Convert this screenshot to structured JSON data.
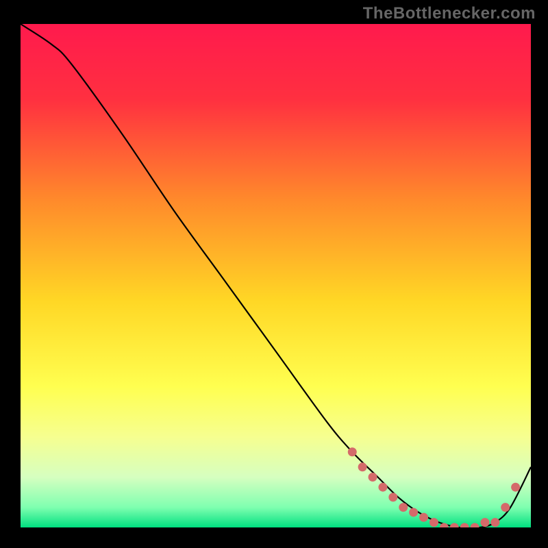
{
  "attribution": "TheBottlenecker.com",
  "chart_data": {
    "type": "line",
    "title": "",
    "xlabel": "",
    "ylabel": "",
    "xlim": [
      0,
      100
    ],
    "ylim": [
      0,
      100
    ],
    "background_gradient_stops": [
      {
        "offset": 0,
        "color": "#ff1a4d"
      },
      {
        "offset": 15,
        "color": "#ff3040"
      },
      {
        "offset": 35,
        "color": "#ff8a2b"
      },
      {
        "offset": 55,
        "color": "#ffd725"
      },
      {
        "offset": 72,
        "color": "#ffff50"
      },
      {
        "offset": 82,
        "color": "#f6ff90"
      },
      {
        "offset": 90,
        "color": "#d6ffc0"
      },
      {
        "offset": 96,
        "color": "#7fffb0"
      },
      {
        "offset": 100,
        "color": "#00e080"
      }
    ],
    "series": [
      {
        "name": "curve",
        "x": [
          0,
          6,
          10,
          20,
          30,
          40,
          50,
          60,
          65,
          70,
          74,
          78,
          82,
          86,
          90,
          93,
          96,
          100
        ],
        "y": [
          100,
          96,
          92,
          78,
          63,
          49,
          35,
          21,
          15,
          10,
          6,
          3,
          1,
          0,
          0,
          1,
          4,
          12
        ]
      }
    ],
    "markers": {
      "name": "dots",
      "color": "#d46a6a",
      "x": [
        65,
        67,
        69,
        71,
        73,
        75,
        77,
        79,
        81,
        83,
        85,
        87,
        89,
        91,
        93,
        95,
        97
      ],
      "y": [
        15,
        12,
        10,
        8,
        6,
        4,
        3,
        2,
        1,
        0,
        0,
        0,
        0,
        1,
        1,
        4,
        8
      ]
    }
  }
}
